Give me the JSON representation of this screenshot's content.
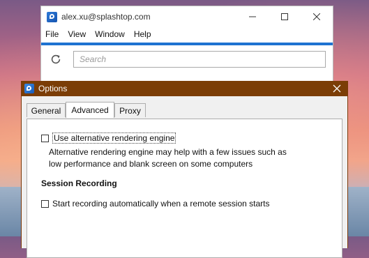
{
  "main_window": {
    "title": "alex.xu@splashtop.com",
    "controls": {
      "minimize": "—",
      "maximize": "☐",
      "close": "✕"
    },
    "menu": [
      "File",
      "View",
      "Window",
      "Help"
    ],
    "search": {
      "placeholder": "Search",
      "value": ""
    }
  },
  "options_dialog": {
    "title": "Options",
    "close": "✕",
    "tabs": [
      {
        "label": "General"
      },
      {
        "label": "Advanced"
      },
      {
        "label": "Proxy"
      }
    ],
    "active_tab": "Advanced",
    "alt_rendering": {
      "label": "Use alternative rendering engine",
      "checked": false,
      "description_line1": "Alternative rendering engine may help with a few issues such as",
      "description_line2": "low performance and blank screen on some computers"
    },
    "session_recording": {
      "heading": "Session Recording",
      "auto_record_label": "Start recording automatically when a remote session starts",
      "checked": false
    }
  },
  "colors": {
    "dialog_title_bar": "#7b3d06",
    "accent_blue": "#1e73d1"
  }
}
